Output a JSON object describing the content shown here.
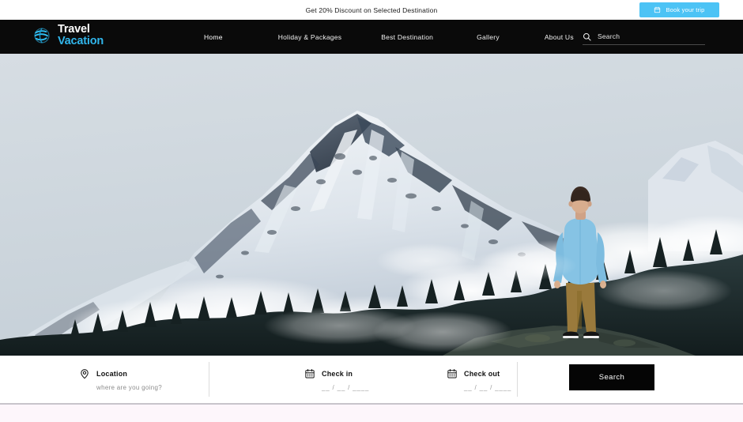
{
  "promo": {
    "text": "Get 20% Discount on Selected Destination",
    "cta_label": "Book your trip",
    "cta_icon": "calendar-icon",
    "cta_color": "#4cc3f5"
  },
  "brand": {
    "line1": "Travel",
    "line2": "Vacation",
    "icon": "globe-icon",
    "accent_color": "#31b6ec"
  },
  "nav": {
    "items": [
      {
        "label": "Home",
        "active": true
      },
      {
        "label": "Holiday & Packages",
        "active": false
      },
      {
        "label": "Best Destination",
        "active": false
      },
      {
        "label": "Gallery",
        "active": false
      },
      {
        "label": "About Us",
        "active": false
      }
    ]
  },
  "search": {
    "icon": "search-icon",
    "placeholder": "Search",
    "value": ""
  },
  "hero": {
    "scene": "snow-covered mountain peak with low clouds, dark pine forest and a man in a light blue sweater standing on a rock",
    "sky_color": "#cfd7de",
    "snow_color": "#e8edf2",
    "rock_color": "#2d3a4a",
    "forest_color": "#1d2a2a",
    "person": {
      "top_color": "#7cc0e0",
      "pants_color": "#9a7a3c",
      "shoes_color": "#1a1a1a",
      "hair_color": "#3a2b22"
    }
  },
  "booking": {
    "location": {
      "icon": "map-pin-icon",
      "label": "Location",
      "placeholder": "where are you going?",
      "value": ""
    },
    "checkin": {
      "icon": "calendar-icon",
      "label": "Check in",
      "placeholder": "__ / __ / ____",
      "value": ""
    },
    "checkout": {
      "icon": "calendar-icon",
      "label": "Check out",
      "placeholder": "__ / __ / ____",
      "value": ""
    },
    "submit_label": "Search",
    "submit_color": "#050505"
  },
  "below_fold": {
    "background": "#fdf6fb"
  }
}
